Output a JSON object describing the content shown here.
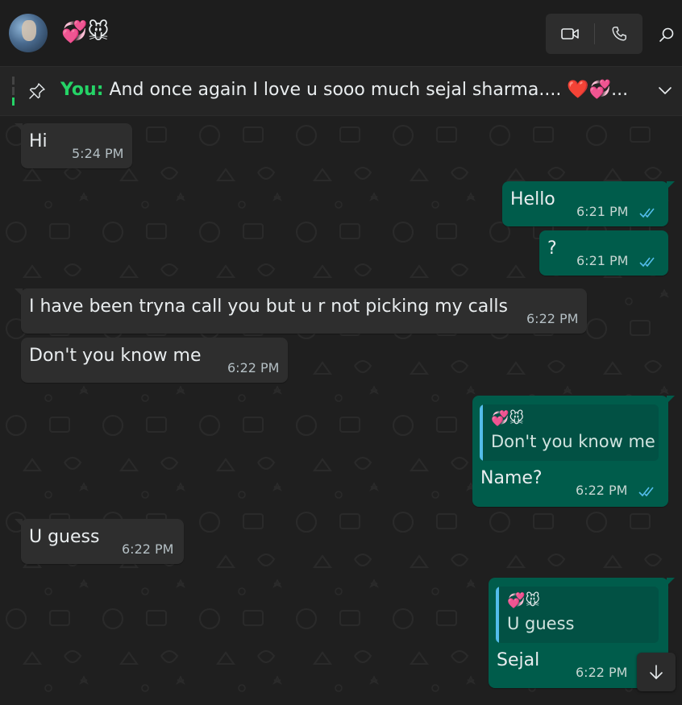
{
  "header": {
    "contact_name": "💞🐭",
    "icons": {
      "avatar": "contact-avatar",
      "video": "video-call-icon",
      "voice": "phone-icon",
      "search": "search-icon"
    }
  },
  "pinned": {
    "sender": "You:",
    "text": "And once again  I love u sooo much sejal sharma.... ❤️💞...",
    "icons": {
      "pin": "pin-icon",
      "expand": "chevron-down-icon"
    }
  },
  "messages": [
    {
      "dir": "in",
      "text": "Hi",
      "time": "5:24 PM"
    },
    {
      "dir": "out",
      "text": "Hello",
      "time": "6:21 PM",
      "status": "read"
    },
    {
      "dir": "out",
      "text": "?",
      "time": "6:21 PM",
      "status": "read"
    },
    {
      "dir": "in",
      "text": "I have been tryna call you but u r not picking my calls",
      "time": "6:22 PM"
    },
    {
      "dir": "in",
      "text": "Don't you know me",
      "time": "6:22 PM"
    },
    {
      "dir": "out",
      "quote_name": "💞🐭",
      "quote_text": "Don't you know me",
      "text": "Name?",
      "time": "6:22 PM",
      "status": "read"
    },
    {
      "dir": "in",
      "text": "U guess",
      "time": "6:22 PM"
    },
    {
      "dir": "out",
      "quote_name": "💞🐭",
      "quote_text": "U guess",
      "text": "Sejal",
      "time": "6:22 PM"
    }
  ],
  "colors": {
    "incoming_bubble": "#2e2e2e",
    "outgoing_bubble": "#005c4b",
    "accent_green": "#25d366",
    "read_ticks": "#53bdeb"
  }
}
